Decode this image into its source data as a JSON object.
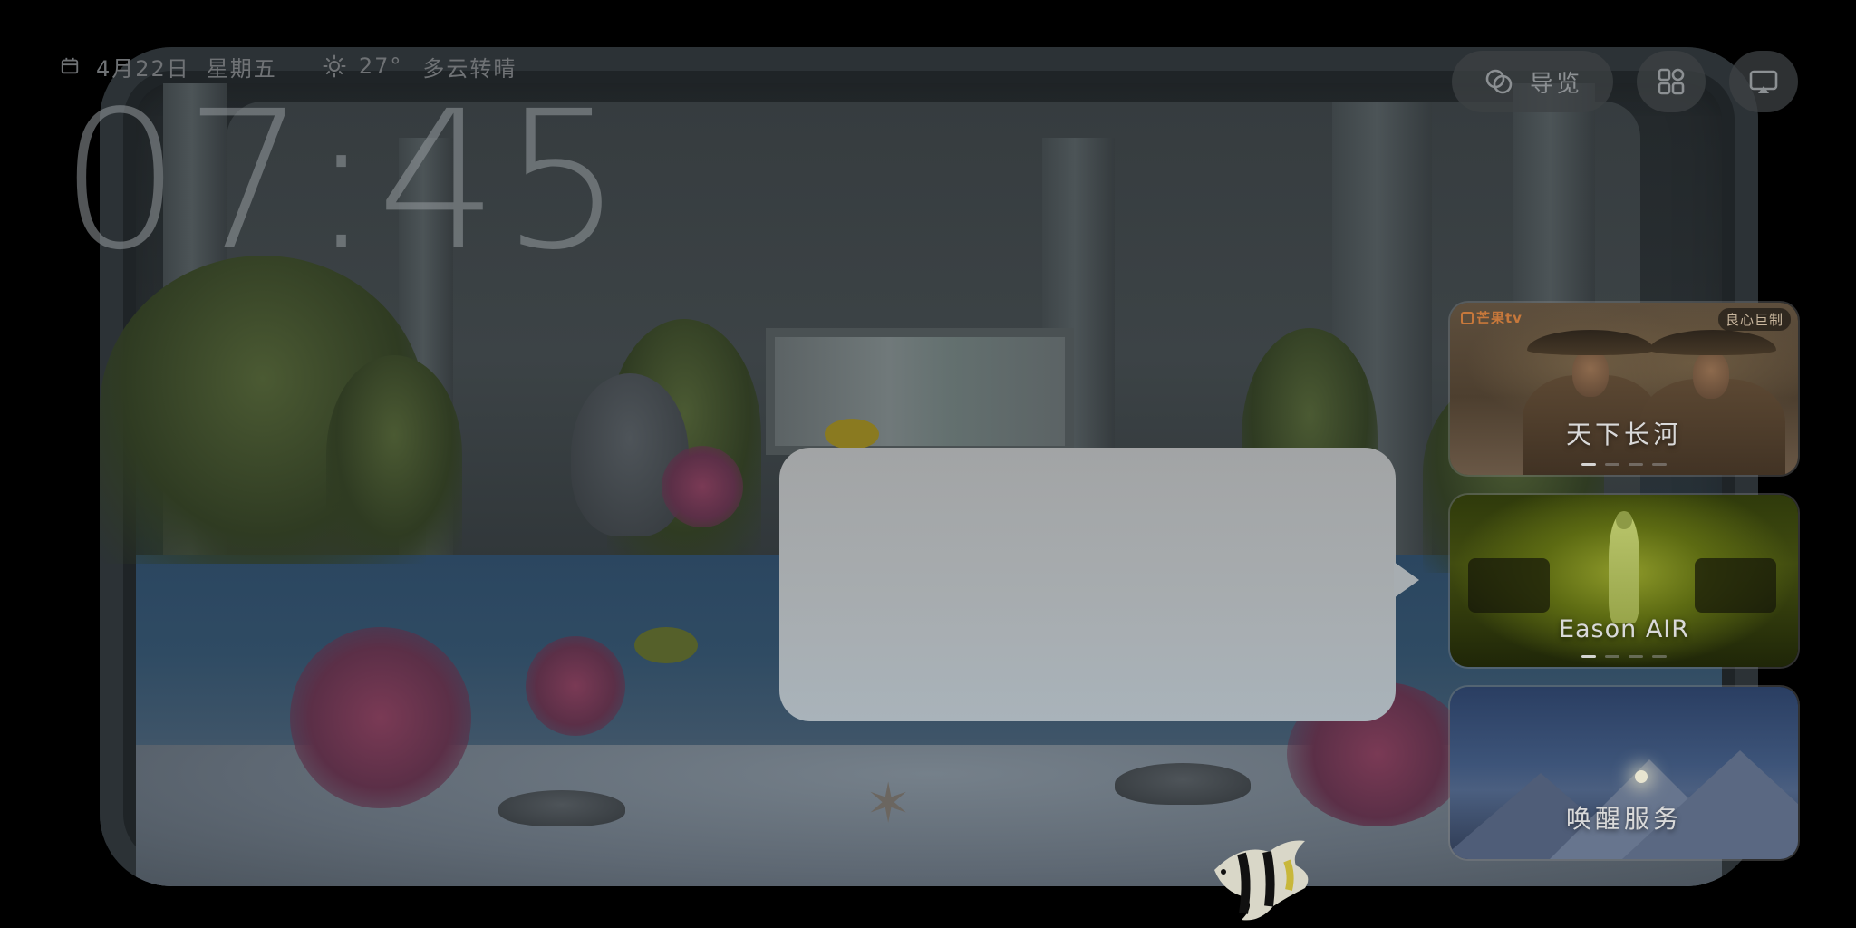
{
  "status_bar": {
    "date": "4月22日",
    "weekday": "星期五",
    "temperature": "27°",
    "condition": "多云转晴",
    "date_icon": "calendar-icon",
    "weather_icon": "sun-icon"
  },
  "clock": {
    "time": "07:45"
  },
  "top_controls": {
    "nav_label": "导览",
    "nav_icon": "overlapping-circles-icon",
    "apps_icon": "apps-grid-icon",
    "cast_icon": "screen-cast-icon"
  },
  "cards": [
    {
      "title": "天下长河",
      "logo": "芒果tv",
      "badge": "良心巨制",
      "dots": 4,
      "active_dot": 0
    },
    {
      "title": "Eason AIR",
      "dots": 4,
      "active_dot": 0
    },
    {
      "title": "唤醒服务"
    }
  ],
  "colors": {
    "background": "#000000",
    "popup": "#a7acaf",
    "muted_text": "#6f7275",
    "card_text": "#d9d9d9"
  }
}
